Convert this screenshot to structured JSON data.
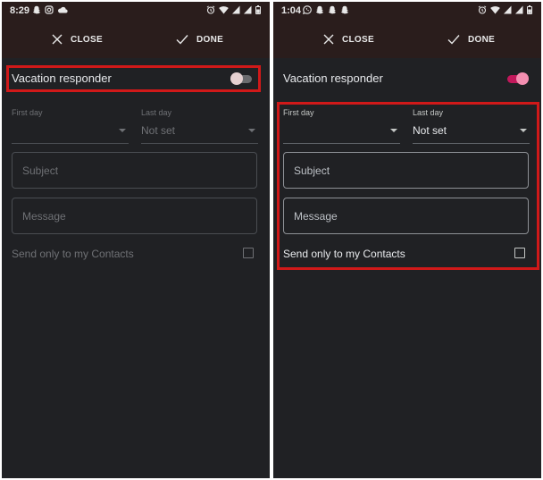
{
  "colors": {
    "accent_highlight": "#d01919",
    "background": "#202124",
    "appbar": "#2a1d1c",
    "toggle_on": "#f48fb1",
    "toggle_off": "#e6d1d1"
  },
  "screens": [
    {
      "status_bar": {
        "time": "8:29",
        "left_icons": [
          "snapchat-icon",
          "instagram-icon",
          "cloud-icon"
        ],
        "right_icons": [
          "alarm-icon",
          "wifi-icon",
          "signal-icon",
          "signal-icon",
          "battery-icon"
        ]
      },
      "toolbar": {
        "close_label": "CLOSE",
        "done_label": "DONE"
      },
      "vacation_responder": {
        "label": "Vacation responder",
        "enabled": false
      },
      "first_day": {
        "label": "First day",
        "value": ""
      },
      "last_day": {
        "label": "Last day",
        "value": "Not set"
      },
      "subject": {
        "placeholder": "Subject"
      },
      "message": {
        "placeholder": "Message"
      },
      "contacts_only": {
        "label": "Send only to my Contacts",
        "checked": false
      },
      "form_enabled": false
    },
    {
      "status_bar": {
        "time": "1:04",
        "left_icons": [
          "whatsapp-icon",
          "snapchat-icon",
          "snapchat-icon",
          "snapchat-icon"
        ],
        "right_icons": [
          "alarm-icon",
          "wifi-icon",
          "signal-icon",
          "signal-icon",
          "battery-icon"
        ]
      },
      "toolbar": {
        "close_label": "CLOSE",
        "done_label": "DONE"
      },
      "vacation_responder": {
        "label": "Vacation responder",
        "enabled": true
      },
      "first_day": {
        "label": "First day",
        "value": ""
      },
      "last_day": {
        "label": "Last day",
        "value": "Not set"
      },
      "subject": {
        "placeholder": "Subject"
      },
      "message": {
        "placeholder": "Message"
      },
      "contacts_only": {
        "label": "Send only to my Contacts",
        "checked": false
      },
      "form_enabled": true
    }
  ]
}
